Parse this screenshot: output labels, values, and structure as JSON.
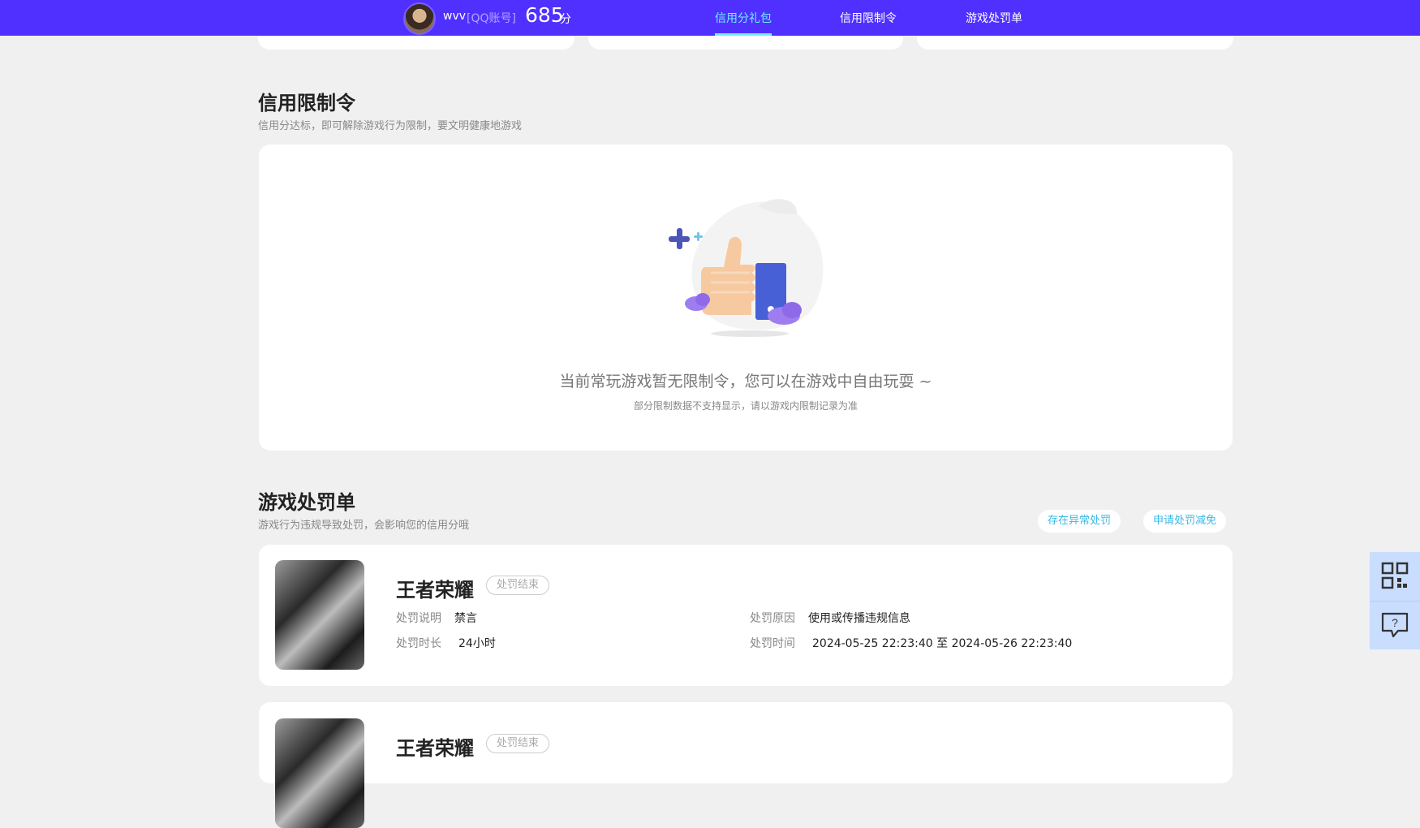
{
  "header": {
    "username": "wvv",
    "account_type": "[QQ账号]",
    "score": "685",
    "score_unit": "分",
    "nav": [
      "信用分礼包",
      "信用限制令",
      "游戏处罚单"
    ],
    "active_nav": 0
  },
  "restriction": {
    "title": "信用限制令",
    "subtitle": "信用分达标，即可解除游戏行为限制，要文明健康地游戏",
    "empty_message": "当前常玩游戏暂无限制令，您可以在游戏中自由玩耍 ~",
    "empty_note": "部分限制数据不支持显示，请以游戏内限制记录为准"
  },
  "penalty": {
    "title": "游戏处罚单",
    "subtitle": "游戏行为违规导致处罚，会影响您的信用分哦",
    "actions": [
      "存在异常处罚",
      "申请处罚减免"
    ],
    "labels": {
      "desc": "处罚说明",
      "duration": "处罚时长",
      "reason": "处罚原因",
      "time": "处罚时间"
    },
    "records": [
      {
        "game": "王者荣耀",
        "status": "处罚结束",
        "desc": "禁言",
        "duration": "24小时",
        "reason": "使用或传播违规信息",
        "time": "2024-05-25 22:23:40 至 2024-05-26 22:23:40"
      },
      {
        "game": "王者荣耀",
        "status": "处罚结束"
      }
    ]
  },
  "sidebar_tools": [
    "qr-code-icon",
    "help-chat-icon"
  ],
  "colors": {
    "header_bg": "#5030ff",
    "nav_active": "#6ef0ff",
    "link": "#39b8e6",
    "page_bg": "#f0f0f0"
  }
}
